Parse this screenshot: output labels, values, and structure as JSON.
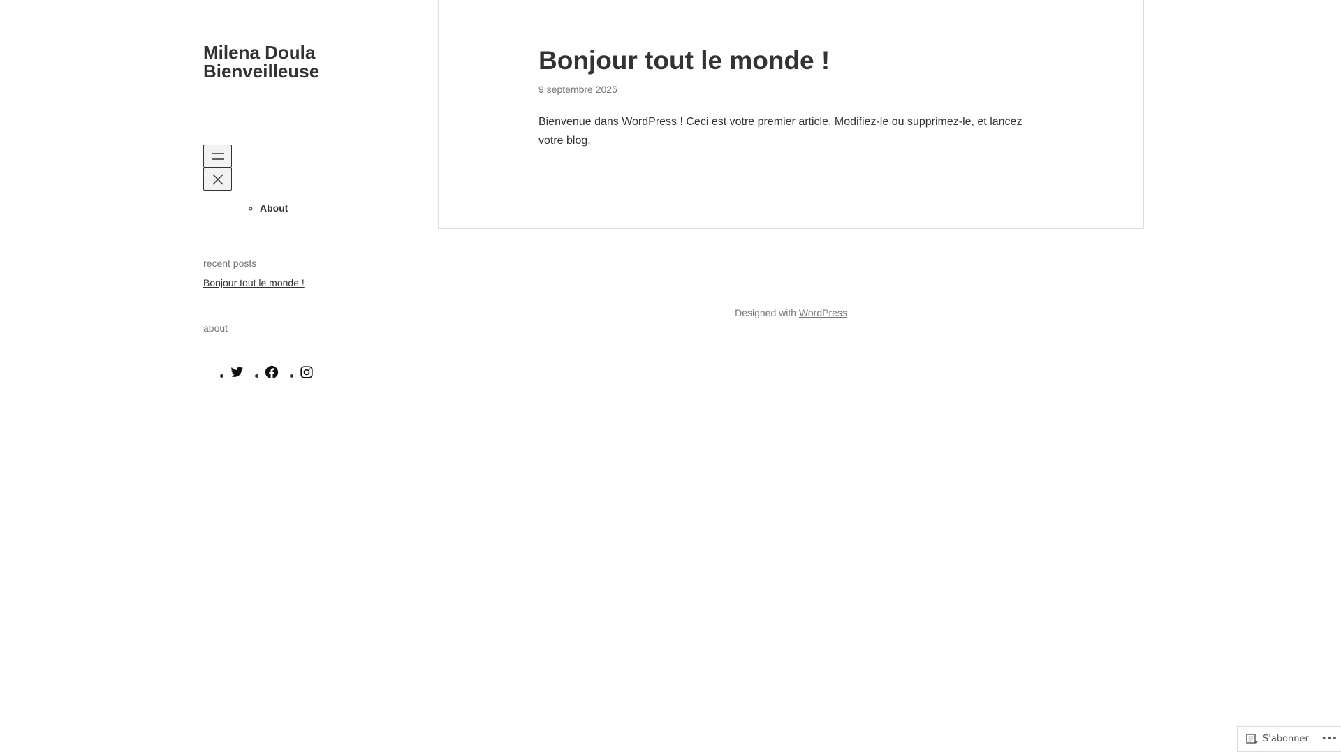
{
  "site": {
    "title_line1": "Milena Doula",
    "title_line2": "Bienveilleuse"
  },
  "nav": {
    "items": [
      {
        "label": "About"
      }
    ]
  },
  "widgets": {
    "recent_posts_title": "recent posts",
    "recent_posts": [
      {
        "label": "Bonjour tout le monde !"
      }
    ],
    "about_title": "about"
  },
  "social": {
    "icons": [
      "twitter-icon",
      "facebook-icon",
      "instagram-icon"
    ]
  },
  "post": {
    "title": "Bonjour tout le monde !",
    "date": "9 septembre 2025",
    "content": "Bienvenue dans WordPress ! Ceci est votre premier article. Modifiez-le ou supprimez-le, et lancez votre blog."
  },
  "footer": {
    "prefix": "Designed with ",
    "link": "WordPress"
  },
  "subscribe": {
    "label": "S'abonner",
    "more": "•••"
  },
  "colors": {
    "text": "#333333",
    "muted": "#757575",
    "border": "#dddddd"
  }
}
